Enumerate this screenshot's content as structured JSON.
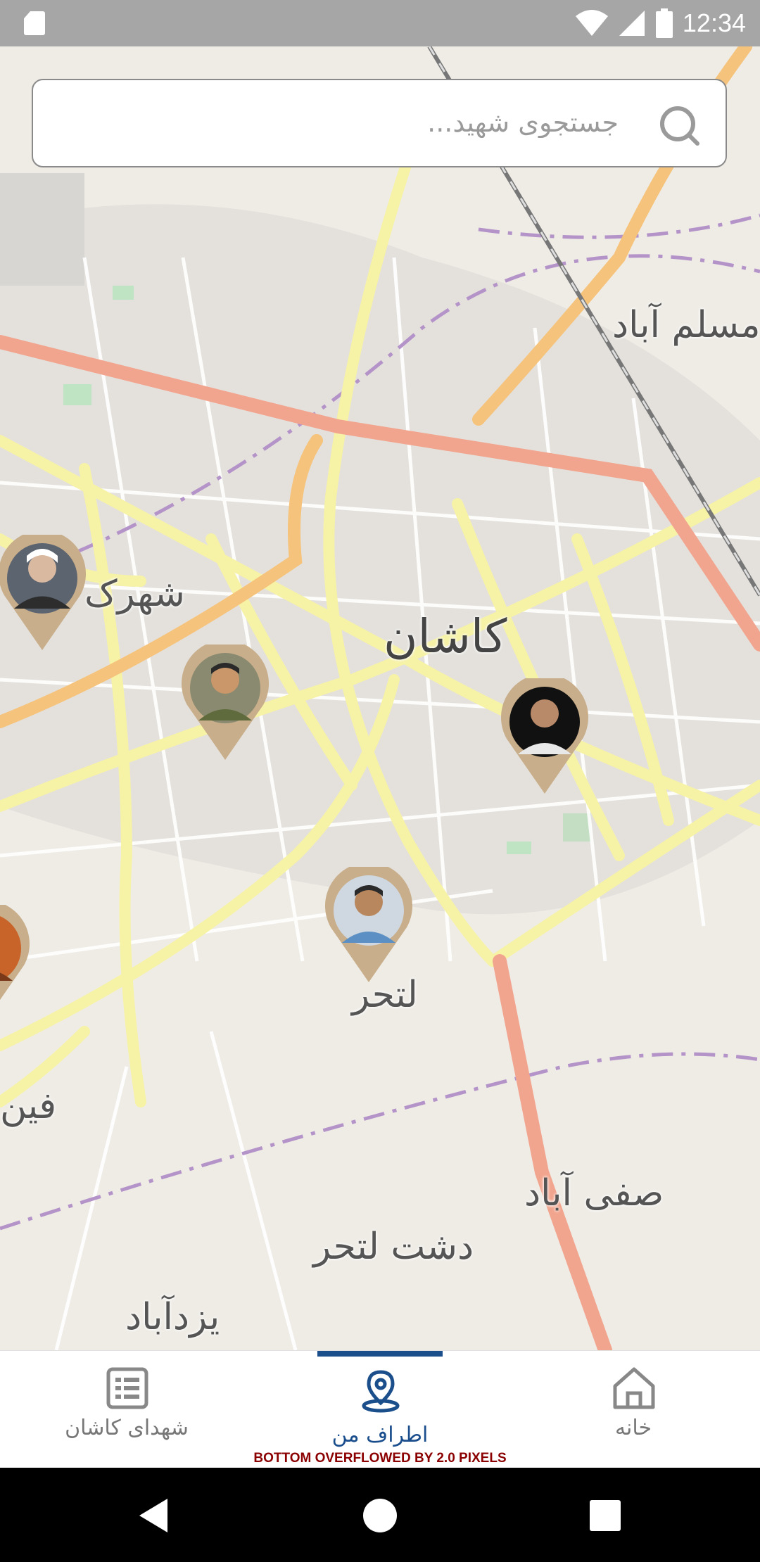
{
  "status_bar": {
    "time": "12:34"
  },
  "search": {
    "placeholder": "جستجوی شهید..."
  },
  "map": {
    "places": [
      {
        "id": "moslem-abad",
        "label": "مسلم آباد"
      },
      {
        "id": "shahrak",
        "label": "شهرک"
      },
      {
        "id": "kashan",
        "label": "کاشان"
      },
      {
        "id": "lotahar",
        "label": "لتحر"
      },
      {
        "id": "fin",
        "label": "فین"
      },
      {
        "id": "safi-abad",
        "label": "صفی آباد"
      },
      {
        "id": "dasht-lotahar",
        "label": "دشت لتحر"
      },
      {
        "id": "yazd-abad",
        "label": "یزدآباد"
      }
    ],
    "markers_count": 5
  },
  "bottom_nav": {
    "items": [
      {
        "label": "شهدای کاشان",
        "icon": "list-icon"
      },
      {
        "label": "اطراف من",
        "icon": "location-pin-icon"
      },
      {
        "label": "خانه",
        "icon": "home-icon"
      }
    ],
    "active_index": 1,
    "debug_overflow": "BOTTOM OVERFLOWED BY 2.0 PIXELS"
  },
  "colors": {
    "accent": "#1b4f8c",
    "marker": "#c8ae8a",
    "major_road": "#f2a58e",
    "road": "#f6f2a6"
  }
}
